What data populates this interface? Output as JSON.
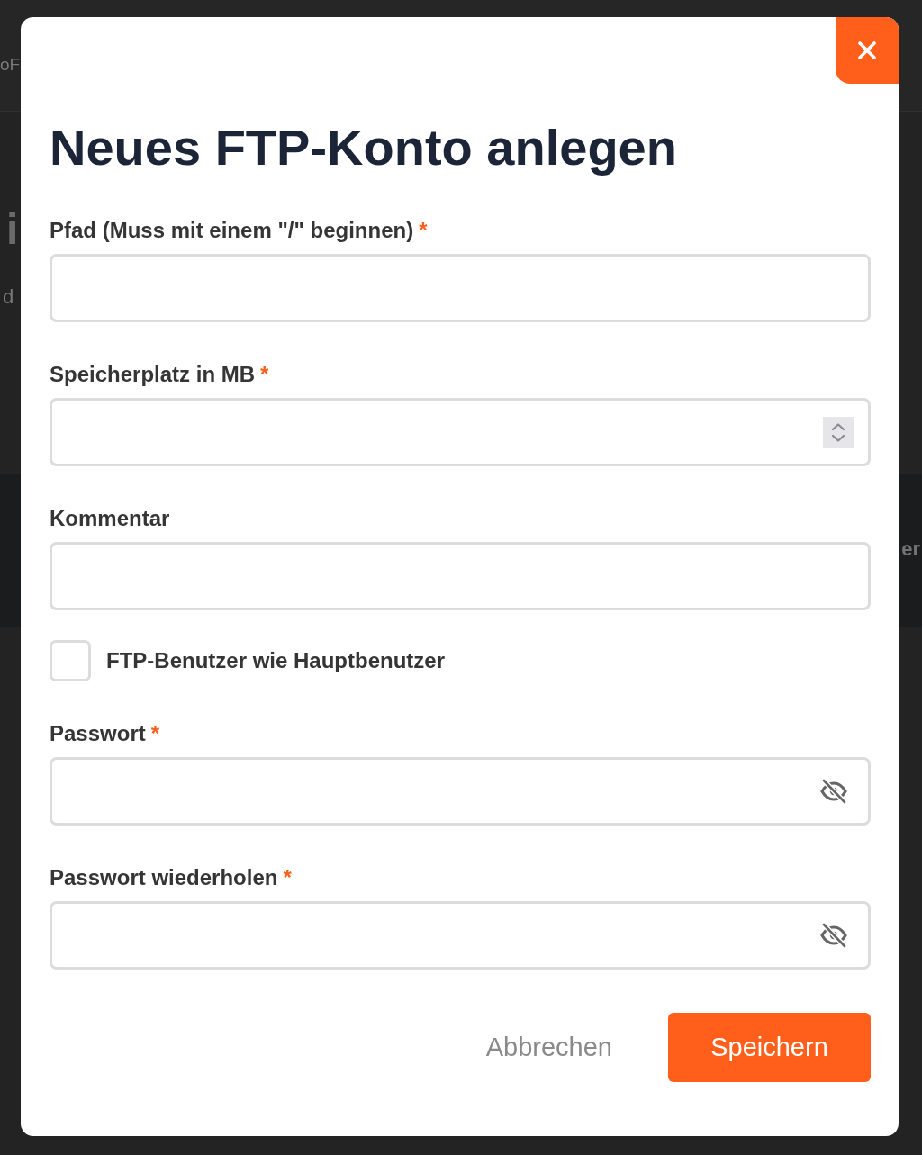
{
  "backdrop": {
    "fragments": [
      {
        "kind": "nav",
        "text": "oF"
      },
      {
        "kind": "heading",
        "text": "i"
      },
      {
        "kind": "text",
        "text": "d"
      },
      {
        "kind": "band",
        "text": "er"
      }
    ]
  },
  "dialog": {
    "title": "Neues FTP-Konto anlegen",
    "fields": [
      {
        "kind": "text",
        "label": "Pfad (Muss mit einem \"/\" beginnen)",
        "required_mark": "*"
      },
      {
        "kind": "number",
        "label": "Speicherplatz in MB",
        "required_mark": "*"
      },
      {
        "kind": "text",
        "label": "Kommentar"
      },
      {
        "kind": "checkbox",
        "label": "FTP-Benutzer wie Hauptbenutzer",
        "checked": false
      },
      {
        "kind": "password",
        "label": "Passwort",
        "required_mark": "*"
      },
      {
        "kind": "password",
        "label": "Passwort wiederholen",
        "required_mark": "*"
      }
    ],
    "buttons": [
      {
        "kind": "secondary",
        "label": "Abbrechen"
      },
      {
        "kind": "primary",
        "label": "Speichern"
      }
    ]
  }
}
